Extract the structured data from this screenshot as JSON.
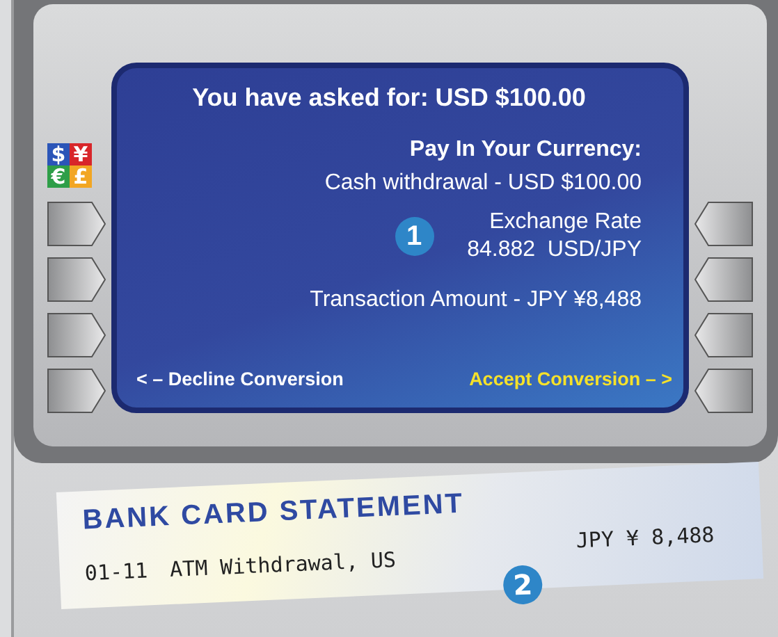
{
  "currency_icon": [
    "$",
    "¥",
    "€",
    "£"
  ],
  "screen": {
    "title": "You have asked for: USD $100.00",
    "heading": "Pay In Your Currency:",
    "withdrawal": "Cash withdrawal - USD $100.00",
    "rate_label": "Exchange Rate",
    "rate_value": "84.882  USD/JPY",
    "callout": "1",
    "transaction": "Transaction Amount - JPY ¥8,488",
    "options": [
      {
        "label": "< – Decline Conversion",
        "kind": "decline"
      },
      {
        "label": "Accept Conversion – >",
        "kind": "accept"
      }
    ]
  },
  "statement": {
    "title": "BANK CARD STATEMENT",
    "date": "01-11",
    "description": "ATM Withdrawal, US",
    "amount": "JPY ¥ 8,488",
    "callout": "2"
  }
}
